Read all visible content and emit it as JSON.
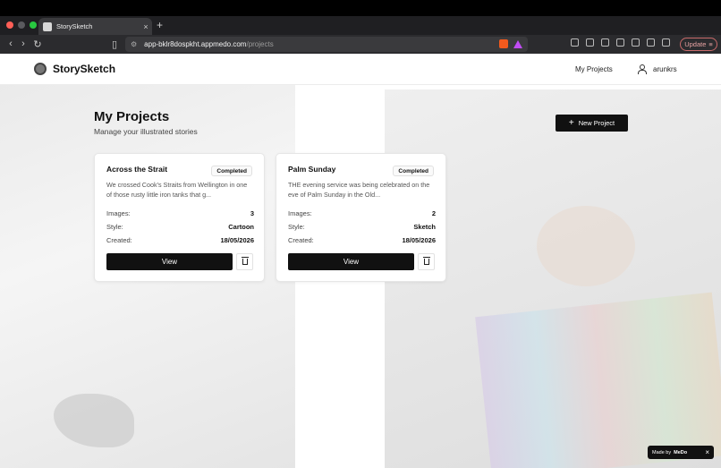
{
  "browser": {
    "tab_title": "StorySketch",
    "tab_close": "×",
    "new_tab": "+",
    "url_host": "app-bklr8dospkht.appmedo.com",
    "url_path": "/projects",
    "update_label": "Update"
  },
  "header": {
    "logo_text": "StorySketch",
    "nav_projects": "My Projects",
    "username": "arunkrs"
  },
  "main": {
    "title": "My Projects",
    "subtitle": "Manage your illustrated stories",
    "new_project_label": "New Project"
  },
  "labels": {
    "images": "Images:",
    "style": "Style:",
    "created": "Created:",
    "view": "View"
  },
  "projects": [
    {
      "title": "Across the Strait",
      "status": "Completed",
      "description": "We crossed Cook's Straits from Wellington in one of those rusty little iron tanks that g...",
      "images": "3",
      "style": "Cartoon",
      "created": "18/05/2026"
    },
    {
      "title": "Palm Sunday",
      "status": "Completed",
      "description": "THE evening service was being celebrated on the eve of Palm Sunday in the Old...",
      "images": "2",
      "style": "Sketch",
      "created": "18/05/2026"
    }
  ],
  "footer_badge": {
    "made_by": "Made by",
    "brand": "MeDo",
    "close": "×"
  }
}
